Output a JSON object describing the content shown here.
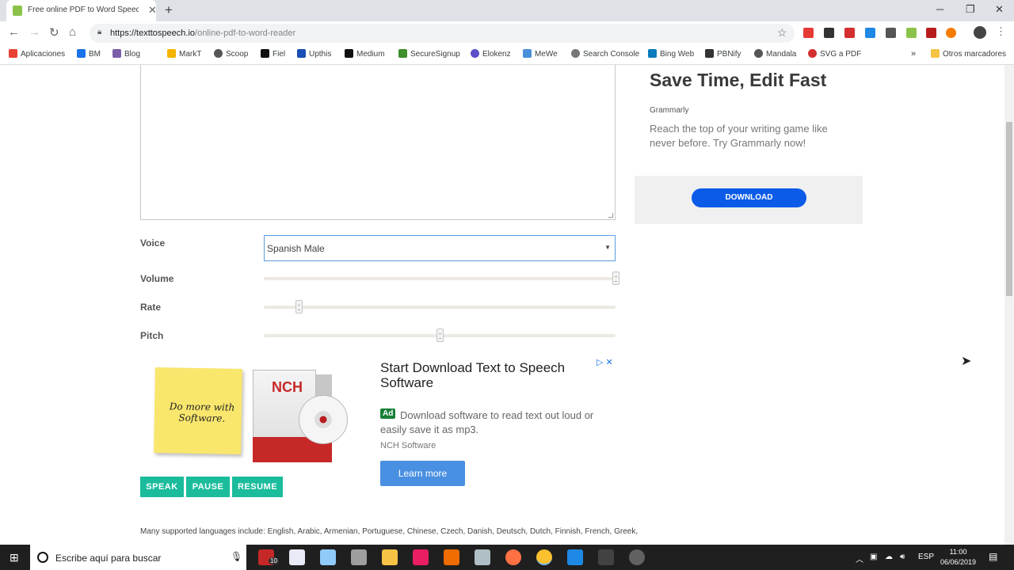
{
  "browser": {
    "tab_title": "Free online PDF to Word Speech",
    "tab_close": "✕",
    "new_tab": "+",
    "url_host": "https://texttospeech.io",
    "url_path": "/online-pdf-to-word-reader",
    "window_minimize": "─",
    "window_restore": "❐",
    "window_close": "✕"
  },
  "bookmarks": [
    {
      "label": "Aplicaciones",
      "color": "#e94235"
    },
    {
      "label": "BM",
      "color": "#1a73e8"
    },
    {
      "label": "Blog",
      "color": "#7b5ea7"
    },
    {
      "label": "MarkT",
      "color": "#f4b400"
    },
    {
      "label": "Scoop",
      "color": "#555555"
    },
    {
      "label": "Fiel",
      "color": "#111111"
    },
    {
      "label": "Upthis",
      "color": "#1a4fb4"
    },
    {
      "label": "Medium",
      "color": "#111111"
    },
    {
      "label": "SecureSignup",
      "color": "#3f8f2a"
    },
    {
      "label": "Elokenz",
      "color": "#5c4ec9"
    },
    {
      "label": "MeWe",
      "color": "#4a8fd9"
    },
    {
      "label": "Search Console",
      "color": "#777777"
    },
    {
      "label": "Bing Web",
      "color": "#0a7bbd"
    },
    {
      "label": "PBNify",
      "color": "#333333"
    },
    {
      "label": "Mandala",
      "color": "#555555"
    },
    {
      "label": "SVG a PDF",
      "color": "#d32f2f"
    }
  ],
  "bookmarks_more": "»",
  "bookmarks_other": "Otros marcadores",
  "form": {
    "voice_label": "Voice",
    "voice_value": "Spanish Male",
    "volume_label": "Volume",
    "volume_value": 1.0,
    "rate_label": "Rate",
    "rate_value": 0.1,
    "pitch_label": "Pitch",
    "pitch_value": 0.5,
    "speak": "SPEAK",
    "pause": "PAUSE",
    "resume": "RESUME"
  },
  "ad_left": {
    "sticky_text": "Do more with Software.",
    "box_logo": "NCH",
    "headline": "Start Download Text to Speech Software",
    "badge": "Ad",
    "description": "Download software to read text out loud or easily save it as mp3.",
    "advertiser": "NCH Software",
    "cta": "Learn more",
    "adchoices": "▷ ✕"
  },
  "languages_text": "Many supported languages include: English, Arabic, Armenian, Portuguese, Chinese, Czech, Danish, Deutsch, Dutch, Finnish, French, Greek,",
  "ad_right": {
    "headline": "Save Time, Edit Fast",
    "brand": "Grammarly",
    "body": "Reach the top of your writing game like never before. Try Grammarly now!",
    "cta": "DOWNLOAD"
  },
  "taskbar": {
    "search_placeholder": "Escribe aquí para buscar",
    "badge_count": "10",
    "language": "ESP",
    "time": "11:00",
    "date": "06/06/2019"
  }
}
